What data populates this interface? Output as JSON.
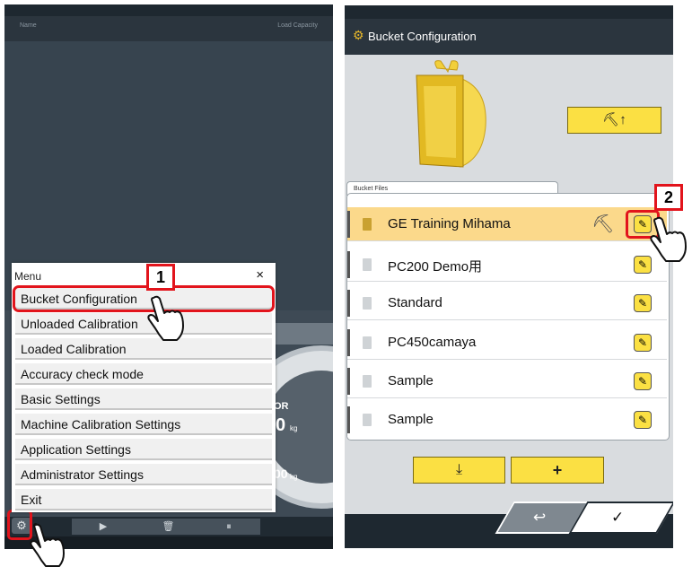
{
  "left_screen": {
    "header": {
      "name_label": "Name",
      "capacity_label": "Load Capacity"
    },
    "menu": {
      "title": "Menu",
      "close": "×",
      "items": [
        "Bucket Configuration",
        "Unloaded Calibration",
        "Loaded Calibration",
        "Accuracy check mode",
        "Basic Settings",
        "Machine Calibration Settings",
        "Application Settings",
        "Administrator Settings",
        "Exit"
      ]
    },
    "gauge_fragments": {
      "a": "OR",
      "b": "0",
      "c": "kg",
      "d": "00",
      "e": "kg"
    },
    "bottom_bar": {
      "play": "▶",
      "trash": "🗑",
      "pause": "⏸"
    },
    "gear_icon": "⚙",
    "callout": "1"
  },
  "right_screen": {
    "title": "Bucket Configuration",
    "gear_icon": "⚙",
    "files_tab_label": "Bucket Files",
    "files": [
      {
        "name": "GE Training Mihama",
        "selected": true
      },
      {
        "name": "PC200 Demo用",
        "selected": false
      },
      {
        "name": "Standard",
        "selected": false
      },
      {
        "name": "PC450camaya",
        "selected": false
      },
      {
        "name": "Sample",
        "selected": false
      },
      {
        "name": "Sample",
        "selected": false
      }
    ],
    "edit_icon": "✎",
    "download_icon": "⤓",
    "add_label": "+",
    "back_icon": "↩",
    "confirm_icon": "✓",
    "callout": "2",
    "accent_color": "#fbe043",
    "highlight_color": "#e2141c"
  }
}
